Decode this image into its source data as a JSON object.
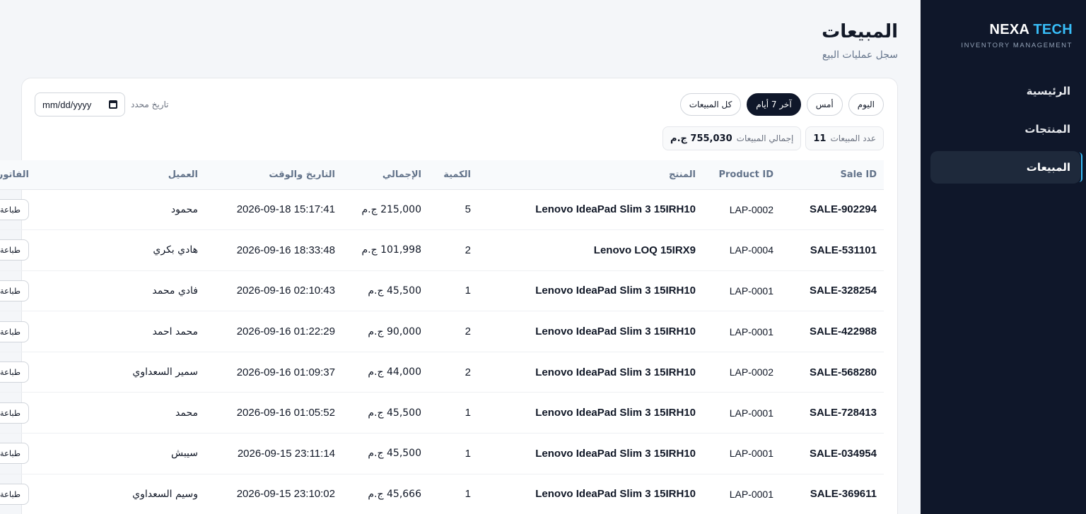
{
  "sidebar": {
    "brand_part1": "NEXA",
    "brand_part2": "TECH",
    "brand_sub": "INVENTORY MANAGEMENT",
    "items": [
      {
        "label": "الرئيسية"
      },
      {
        "label": "المنتجات"
      },
      {
        "label": "المبيعات",
        "active": true
      }
    ]
  },
  "header": {
    "title": "المبيعات",
    "subtitle": "سجل عمليات البيع"
  },
  "filters": {
    "today": "اليوم",
    "yesterday": "أمس",
    "last7": "آخر 7 أيام",
    "all": "كل المبيعات",
    "active": "last7",
    "date_label": "تاريخ محدد",
    "date_placeholder": "mm/dd/yyyy"
  },
  "stats": {
    "count_label": "عدد المبيعات",
    "count_value": "11",
    "total_label": "إجمالي المبيعات",
    "total_value": "755,030 ج.م"
  },
  "table": {
    "headers": {
      "sale_id": "Sale ID",
      "product_id": "Product ID",
      "product": "المنتج",
      "qty": "الكمية",
      "total": "الإجمالي",
      "datetime": "التاريخ والوقت",
      "customer": "العميل",
      "invoice": "الفاتورة"
    },
    "print_label": "طباعة",
    "rows": [
      {
        "sale_id": "SALE-902294",
        "product_id": "LAP-0002",
        "product": "Lenovo IdeaPad Slim 3 15IRH10",
        "qty": "5",
        "total": "215,000 ج.م",
        "datetime": "2026-09-18 15:17:41",
        "customer": "محمود"
      },
      {
        "sale_id": "SALE-531101",
        "product_id": "LAP-0004",
        "product": "Lenovo LOQ 15IRX9",
        "qty": "2",
        "total": "101,998 ج.م",
        "datetime": "2026-09-16 18:33:48",
        "customer": "هادي بكري"
      },
      {
        "sale_id": "SALE-328254",
        "product_id": "LAP-0001",
        "product": "Lenovo IdeaPad Slim 3 15IRH10",
        "qty": "1",
        "total": "45,500 ج.م",
        "datetime": "2026-09-16 02:10:43",
        "customer": "فادي محمد"
      },
      {
        "sale_id": "SALE-422988",
        "product_id": "LAP-0001",
        "product": "Lenovo IdeaPad Slim 3 15IRH10",
        "qty": "2",
        "total": "90,000 ج.م",
        "datetime": "2026-09-16 01:22:29",
        "customer": "محمد احمد"
      },
      {
        "sale_id": "SALE-568280",
        "product_id": "LAP-0002",
        "product": "Lenovo IdeaPad Slim 3 15IRH10",
        "qty": "2",
        "total": "44,000 ج.م",
        "datetime": "2026-09-16 01:09:37",
        "customer": "سمير السعداوي"
      },
      {
        "sale_id": "SALE-728413",
        "product_id": "LAP-0001",
        "product": "Lenovo IdeaPad Slim 3 15IRH10",
        "qty": "1",
        "total": "45,500 ج.م",
        "datetime": "2026-09-16 01:05:52",
        "customer": "محمد"
      },
      {
        "sale_id": "SALE-034954",
        "product_id": "LAP-0001",
        "product": "Lenovo IdeaPad Slim 3 15IRH10",
        "qty": "1",
        "total": "45,500 ج.م",
        "datetime": "2026-09-15 23:11:14",
        "customer": "سيبش"
      },
      {
        "sale_id": "SALE-369611",
        "product_id": "LAP-0001",
        "product": "Lenovo IdeaPad Slim 3 15IRH10",
        "qty": "1",
        "total": "45,666 ج.م",
        "datetime": "2026-09-15 23:10:02",
        "customer": "وسيم السعداوي"
      }
    ]
  }
}
